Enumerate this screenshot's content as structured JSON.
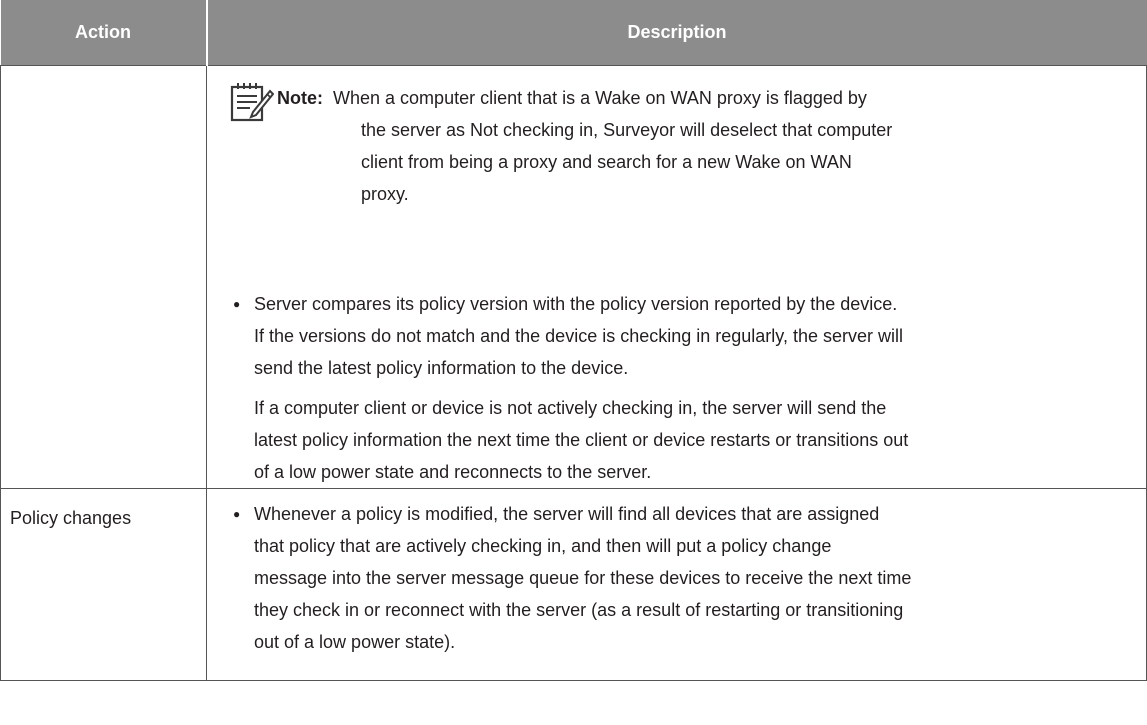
{
  "table": {
    "headers": {
      "action": "Action",
      "description": "Description"
    },
    "rows": [
      {
        "action": "",
        "note": {
          "label": "Note:",
          "line1": "When a computer client that is a Wake on WAN proxy is flagged by",
          "line2": "the server as Not checking in, Surveyor will deselect that computer",
          "line3": "client from being a proxy and search for a new Wake on WAN",
          "line4": "proxy."
        },
        "bullet": {
          "line1": "Server compares its policy version with the policy version reported by the device.",
          "line2": "If the versions do not match and the device is checking in regularly, the server will",
          "line3": "send the latest policy information to the device."
        },
        "paragraph": {
          "line1": "If a computer client or device is not actively checking in, the server will send the",
          "line2": "latest policy information the next time the client or device restarts or transitions out",
          "line3": "of a low power state and reconnects to the server."
        }
      },
      {
        "action": "Policy changes",
        "bullet": {
          "line1": "Whenever a policy is modified, the server will find all devices that are assigned",
          "line2": "that policy that are actively checking in, and then will put a policy change",
          "line3": "message into the server message queue for these devices to receive the next time",
          "line4": "they check in or reconnect with the server (as a result of restarting or transitioning",
          "line5": "out of a low power state)."
        }
      }
    ]
  },
  "icons": {
    "note": "note-pencil-icon",
    "bullet": "bullet-dot-icon"
  },
  "colors": {
    "header_bg": "#8c8c8c",
    "header_text": "#ffffff",
    "body_text": "#231f20",
    "border": "#555555"
  }
}
